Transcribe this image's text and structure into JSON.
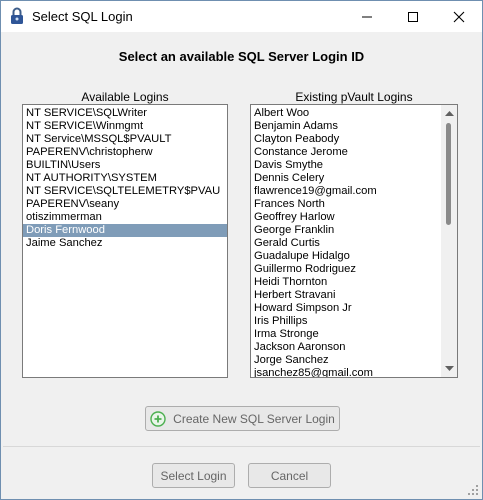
{
  "window": {
    "title": "Select SQL Login"
  },
  "heading": "Select an available SQL Server Login ID",
  "available": {
    "label": "Available Logins",
    "items": [
      "NT SERVICE\\SQLWriter",
      "NT SERVICE\\Winmgmt",
      "NT Service\\MSSQL$PVAULT",
      "PAPERENV\\christopherw",
      "BUILTIN\\Users",
      "NT AUTHORITY\\SYSTEM",
      "NT SERVICE\\SQLTELEMETRY$PVAU",
      "PAPERENV\\seany",
      "otiszimmerman",
      "Doris Fernwood",
      "Jaime Sanchez"
    ],
    "selected_index": 9
  },
  "existing": {
    "label": "Existing pVault Logins",
    "items": [
      "Albert Woo",
      "Benjamin Adams",
      "Clayton Peabody",
      "Constance Jerome",
      "Davis Smythe",
      "Dennis Celery",
      "flawrence19@gmail.com",
      "Frances North",
      "Geoffrey Harlow",
      "George Franklin",
      "Gerald Curtis",
      "Guadalupe Hidalgo",
      "Guillermo Rodriguez",
      "Heidi Thornton",
      "Herbert Stravani",
      "Howard Simpson Jr",
      "Iris Phillips",
      "Irma Stronge",
      "Jackson Aaronson",
      "Jorge Sanchez",
      "jsanchez85@gmail.com"
    ],
    "scroll_position": 0.0
  },
  "buttons": {
    "create": "Create New SQL Server Login",
    "select": "Select Login",
    "cancel": "Cancel"
  },
  "colors": {
    "selection": "#7f9cb8",
    "create_icon": "#4caf50"
  }
}
